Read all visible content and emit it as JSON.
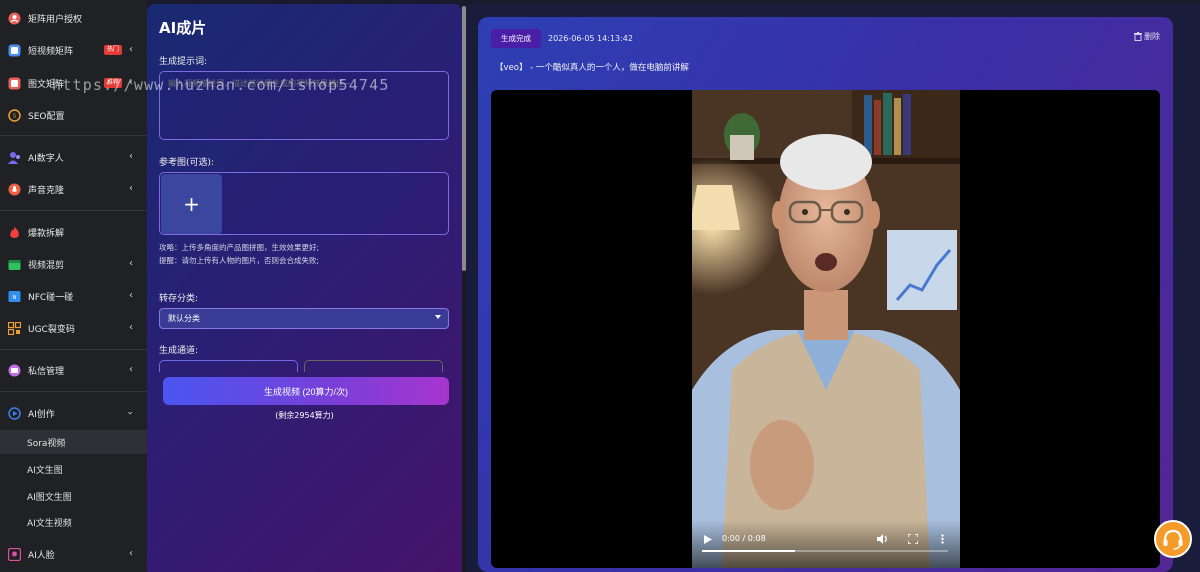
{
  "sidebar": {
    "items": [
      {
        "label": "矩阵用户授权",
        "icon": "user-auth-icon",
        "color": "#e8605a"
      },
      {
        "label": "短视频矩阵",
        "icon": "video-matrix-icon",
        "badge": "热门",
        "color": "#4a8ef0"
      },
      {
        "label": "图文矩阵",
        "icon": "image-text-icon",
        "badge": "推荐",
        "color": "#e8605a"
      },
      {
        "label": "SEO配置",
        "icon": "seo-icon",
        "color": "#f0a030"
      },
      {
        "label": "AI数字人",
        "icon": "digital-human-icon",
        "color": "#7a6cf0"
      },
      {
        "label": "声音克隆",
        "icon": "voice-clone-icon",
        "color": "#f06040"
      },
      {
        "label": "爆款拆解",
        "icon": "fire-icon",
        "color": "#f04040"
      },
      {
        "label": "视频混剪",
        "icon": "video-mix-icon",
        "color": "#30c060"
      },
      {
        "label": "NFC碰一碰",
        "icon": "nfc-icon",
        "color": "#3090f0"
      },
      {
        "label": "UGC裂变码",
        "icon": "qr-code-icon",
        "color": "#f0a030"
      },
      {
        "label": "私信管理",
        "icon": "message-icon",
        "color": "#c070e0"
      },
      {
        "label": "AI创作",
        "icon": "play-circle-icon",
        "color": "#3a80f0"
      },
      {
        "label": "AI人脸",
        "icon": "face-icon",
        "color": "#e050a0"
      }
    ],
    "sub_items": [
      "Sora视频",
      "AI文生图",
      "AI图文生图",
      "AI文生视频"
    ]
  },
  "watermark": "https://www.huzhan.com/ishop54745",
  "panel": {
    "title": "AI成片",
    "prompt_label": "生成提示词:",
    "prompt_placeholder": "输入视频描述词，描述越详细生成的视频效果越佳~",
    "ref_label": "参考图(可选):",
    "upload_symbol": "+",
    "tip1": "攻略：上传多角度的产品图拼图，生效效果更好;",
    "tip2": "提醒：请勿上传有人物的图片，否则会合成失败;",
    "category_label": "转存分类:",
    "category_value": "默认分类",
    "channel_label": "生成通道:",
    "generate_button": "生成视频 (20算力/次)",
    "remaining": "(剩余2954算力)"
  },
  "result": {
    "status": "生成完成",
    "timestamp": "2026-06-05 14:13:42",
    "delete_label": "删除",
    "description": "【veo】 - 一个酷似真人的一个人，做在电脑前讲解",
    "video_time": "0:00 / 0:08",
    "progress": 0.38
  }
}
